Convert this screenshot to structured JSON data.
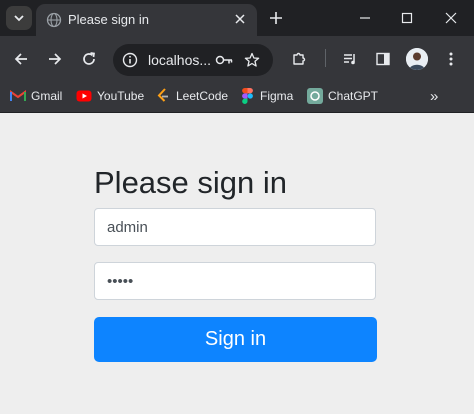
{
  "browser": {
    "tab": {
      "title": "Please sign in"
    },
    "omnibox": {
      "url": "localhos..."
    },
    "bookmarks": [
      {
        "label": "Gmail",
        "icon": "gmail-icon"
      },
      {
        "label": "YouTube",
        "icon": "youtube-icon"
      },
      {
        "label": "LeetCode",
        "icon": "leetcode-icon"
      },
      {
        "label": "Figma",
        "icon": "figma-icon"
      },
      {
        "label": "ChatGPT",
        "icon": "chatgpt-icon"
      }
    ],
    "bookmarks_overflow": "»"
  },
  "page": {
    "heading": "Please sign in",
    "username": {
      "value": "admin"
    },
    "password": {
      "value": "admin"
    },
    "submit_label": "Sign in"
  },
  "colors": {
    "primary_button": "#0d84ff",
    "page_background": "#eeeeee",
    "browser_chrome": "#35363a"
  }
}
